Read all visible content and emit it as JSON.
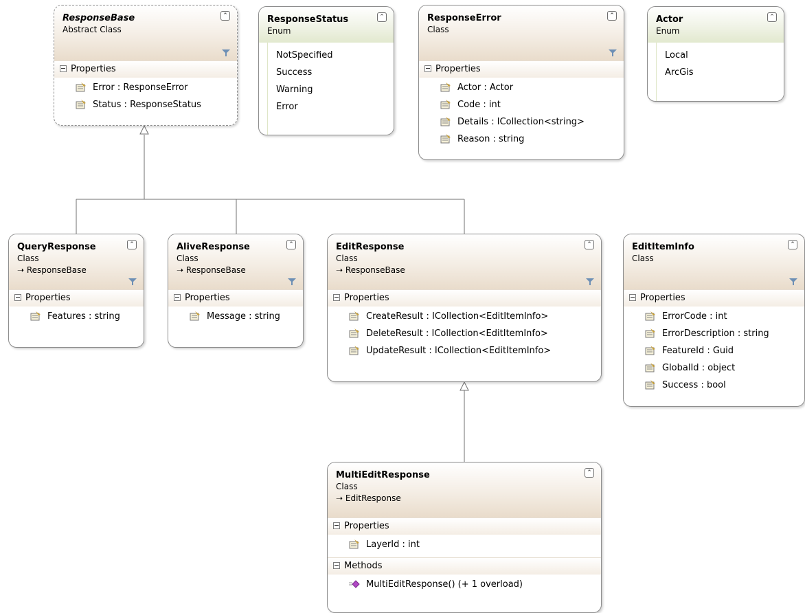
{
  "diagram": {
    "shapes": {
      "response_base": {
        "name": "ResponseBase",
        "kind": "Abstract Class",
        "section": "Properties",
        "properties": [
          "Error : ResponseError",
          "Status : ResponseStatus"
        ]
      },
      "response_status": {
        "name": "ResponseStatus",
        "kind": "Enum",
        "values": [
          "NotSpecified",
          "Success",
          "Warning",
          "Error"
        ]
      },
      "response_error": {
        "name": "ResponseError",
        "kind": "Class",
        "section": "Properties",
        "properties": [
          "Actor : Actor",
          "Code : int",
          "Details : ICollection<string>",
          "Reason : string"
        ]
      },
      "actor": {
        "name": "Actor",
        "kind": "Enum",
        "values": [
          "Local",
          "ArcGis"
        ]
      },
      "query_response": {
        "name": "QueryResponse",
        "kind": "Class",
        "base": "ResponseBase",
        "section": "Properties",
        "properties": [
          "Features : string"
        ]
      },
      "alive_response": {
        "name": "AliveResponse",
        "kind": "Class",
        "base": "ResponseBase",
        "section": "Properties",
        "properties": [
          "Message : string"
        ]
      },
      "edit_response": {
        "name": "EditResponse",
        "kind": "Class",
        "base": "ResponseBase",
        "section": "Properties",
        "properties": [
          "CreateResult : ICollection<EditItemInfo>",
          "DeleteResult : ICollection<EditItemInfo>",
          "UpdateResult : ICollection<EditItemInfo>"
        ]
      },
      "edit_item_info": {
        "name": "EditItemInfo",
        "kind": "Class",
        "section": "Properties",
        "properties": [
          "ErrorCode : int",
          "ErrorDescription : string",
          "FeatureId : Guid",
          "GlobalId : object",
          "Success : bool"
        ]
      },
      "multi_edit_response": {
        "name": "MultiEditResponse",
        "kind": "Class",
        "base": "EditResponse",
        "section": "Properties",
        "properties": [
          "LayerId : int"
        ],
        "methods_section": "Methods",
        "methods": [
          "MultiEditResponse() (+ 1 overload)"
        ]
      }
    },
    "icons": {
      "collapse": "double-chevron-up-icon",
      "filter": "filter-icon",
      "property": "property-icon",
      "method": "method-icon",
      "inherits": "inheritance-arrow-icon"
    },
    "colors": {
      "class_header": "#e9dccb",
      "enum_header": "#e2e9cf",
      "border": "#8d8d8d",
      "connector": "#707070"
    },
    "relations": [
      {
        "from": "QueryResponse",
        "to": "ResponseBase",
        "type": "inheritance"
      },
      {
        "from": "AliveResponse",
        "to": "ResponseBase",
        "type": "inheritance"
      },
      {
        "from": "EditResponse",
        "to": "ResponseBase",
        "type": "inheritance"
      },
      {
        "from": "MultiEditResponse",
        "to": "EditResponse",
        "type": "inheritance"
      }
    ]
  }
}
